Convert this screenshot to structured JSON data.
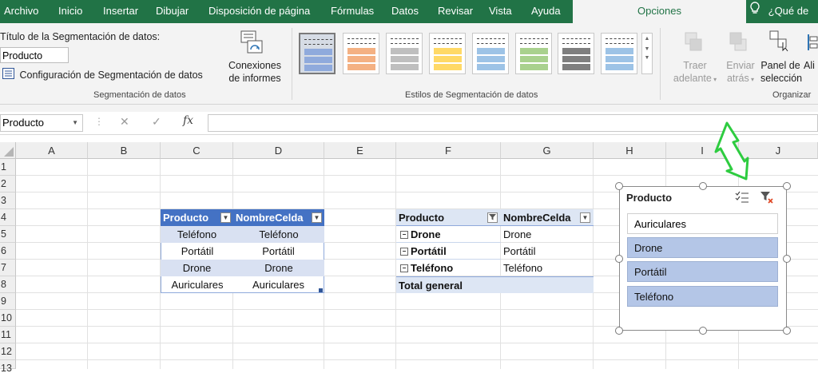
{
  "tabs": [
    "Archivo",
    "Inicio",
    "Insertar",
    "Dibujar",
    "Disposición de página",
    "Fórmulas",
    "Datos",
    "Revisar",
    "Vista",
    "Ayuda",
    "Opciones"
  ],
  "tell_me": "¿Qué de",
  "ribbon": {
    "caption_label": "Título de la Segmentación de datos:",
    "caption_value": "Producto",
    "slicer_settings": "Configuración de Segmentación de datos",
    "connections_line1": "Conexiones",
    "connections_line2": "de informes",
    "group_slicer": "Segmentación de datos",
    "group_styles": "Estilos de Segmentación de datos",
    "bring_forward_1": "Traer",
    "bring_forward_2": "adelante",
    "send_back_1": "Enviar",
    "send_back_2": "atrás",
    "selection_pane_1": "Panel de",
    "selection_pane_2": "selección",
    "align": "Ali",
    "group_arrange": "Organizar"
  },
  "formula_bar": {
    "name_box": "Producto",
    "fx": "fx",
    "cancel": "✕",
    "enter": "✓",
    "value": ""
  },
  "columns": [
    "A",
    "B",
    "C",
    "D",
    "E",
    "F",
    "G",
    "H",
    "I",
    "J"
  ],
  "rows": [
    "1",
    "2",
    "3",
    "4",
    "5",
    "6",
    "7",
    "8",
    "9",
    "10",
    "11",
    "12",
    "13"
  ],
  "table": {
    "headers": [
      "Producto",
      "NombreCelda"
    ],
    "rows": [
      [
        "Teléfono",
        "Teléfono"
      ],
      [
        "Portátil",
        "Portátil"
      ],
      [
        "Drone",
        "Drone"
      ],
      [
        "Auriculares",
        "Auriculares"
      ]
    ]
  },
  "pivot": {
    "headers": [
      "Producto",
      "NombreCelda"
    ],
    "rows": [
      [
        "Drone",
        "Drone"
      ],
      [
        "Portátil",
        "Portátil"
      ],
      [
        "Teléfono",
        "Teléfono"
      ]
    ],
    "total": "Total general",
    "expander": "−"
  },
  "slicer": {
    "title": "Producto",
    "items": [
      {
        "label": "Auriculares",
        "selected": false
      },
      {
        "label": "Drone",
        "selected": true
      },
      {
        "label": "Portátil",
        "selected": true
      },
      {
        "label": "Teléfono",
        "selected": true
      }
    ]
  },
  "colors": {
    "excel_green": "#217346",
    "table_header": "#4472c4",
    "table_band": "#d9e1f2",
    "slicer_selected": "#b4c6e7",
    "arrow_green": "#2ecc40"
  }
}
